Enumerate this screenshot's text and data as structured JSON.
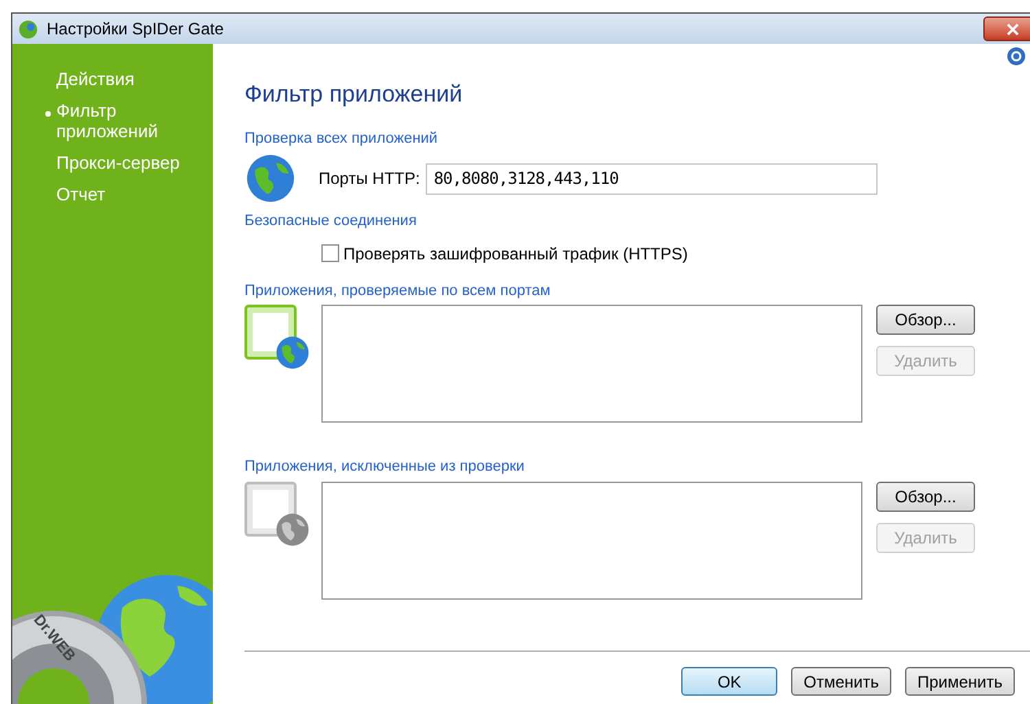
{
  "window": {
    "title": "Настройки SpIDer Gate"
  },
  "sidebar": {
    "items": [
      {
        "label": "Действия",
        "selected": false
      },
      {
        "label": "Фильтр приложений",
        "selected": true
      },
      {
        "label": "Прокси-сервер",
        "selected": false
      },
      {
        "label": "Отчет",
        "selected": false
      }
    ],
    "logo_text": "Dr.WEB"
  },
  "page": {
    "title": "Фильтр приложений"
  },
  "all_apps": {
    "heading": "Проверка всех приложений",
    "ports_label": "Порты HTTP:",
    "ports_value": "80,8080,3128,443,110"
  },
  "secure": {
    "heading": "Безопасные соединения",
    "checkbox": {
      "label": "Проверять зашифрованный трафик (HTTPS)",
      "checked": false
    }
  },
  "lists": [
    {
      "kind": "included",
      "heading": "Приложения, проверяемые по всем портам",
      "browse": {
        "label": "Обзор...",
        "disabled": false
      },
      "remove": {
        "label": "Удалить",
        "disabled": true
      }
    },
    {
      "kind": "excluded",
      "heading": "Приложения, исключенные из проверки",
      "browse": {
        "label": "Обзор...",
        "disabled": false
      },
      "remove": {
        "label": "Удалить",
        "disabled": true
      }
    }
  ],
  "buttons": [
    {
      "label": "OK",
      "kind": "default"
    },
    {
      "label": "Отменить",
      "kind": "normal"
    },
    {
      "label": "Применить",
      "kind": "normal"
    }
  ]
}
